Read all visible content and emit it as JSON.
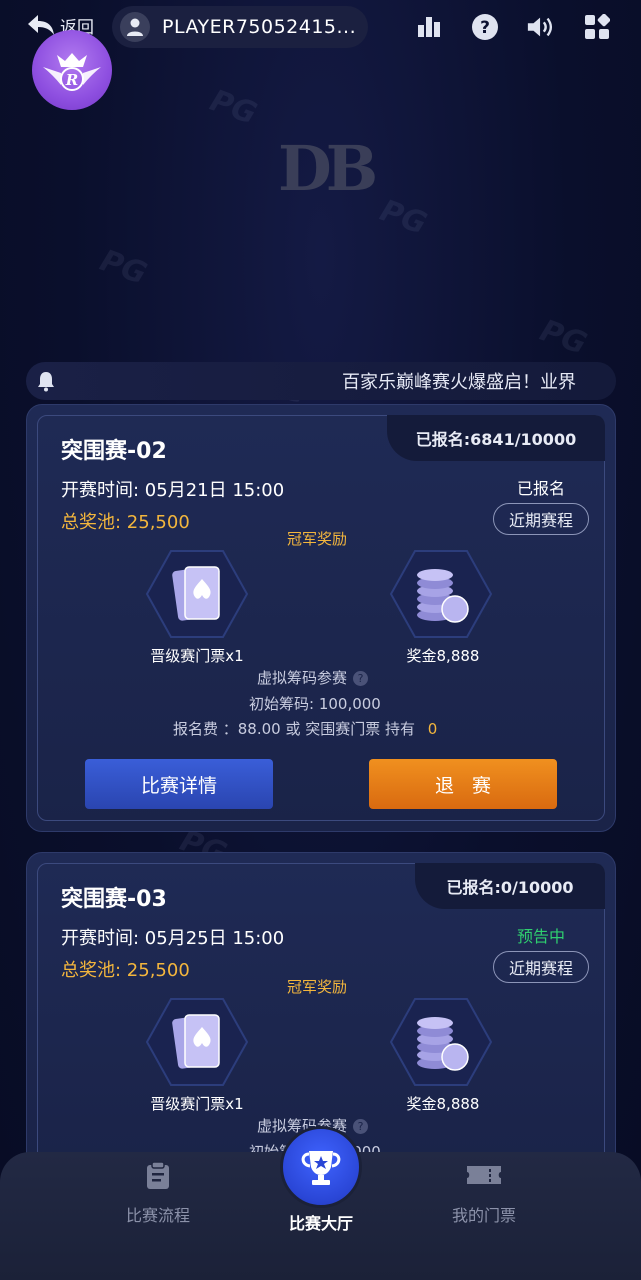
{
  "header": {
    "back_label": "返回",
    "player_name": "PLAYER75052415...",
    "icons": [
      "back-arrow-icon",
      "user-icon",
      "leaderboard-icon",
      "help-icon",
      "volume-icon",
      "menu-grid-icon"
    ]
  },
  "logo": {
    "badge_letter": "R",
    "brand_mark": "DB"
  },
  "notice": {
    "text": "百家乐巅峰赛火爆盛启！业界"
  },
  "tournaments": [
    {
      "title": "突围赛-02",
      "registered": "已报名:6841/10000",
      "start_time": "开赛时间: 05月21日 15:00",
      "prize_pool": "总奖池: 25,500",
      "status": "已报名",
      "schedule_btn": "近期赛程",
      "champion_label": "冠军奖励",
      "reward_ticket": "晋级赛门票x1",
      "reward_bonus": "奖金8,888",
      "virtual_chips": "虚拟筹码参赛",
      "initial_chips": "初始筹码: 100,000",
      "entry_fee": "报名费 ：88.00 或 突围赛门票 持有",
      "tickets_held": "0",
      "detail_btn": "比赛详情",
      "action_btn": "退赛"
    },
    {
      "title": "突围赛-03",
      "registered": "已报名:0/10000",
      "start_time": "开赛时间: 05月25日 15:00",
      "prize_pool": "总奖池: 25,500",
      "status": "预告中",
      "schedule_btn": "近期赛程",
      "champion_label": "冠军奖励",
      "reward_ticket": "晋级赛门票x1",
      "reward_bonus": "奖金8,888",
      "virtual_chips": "虚拟筹码参赛",
      "initial_chips": "初始筹码: 100,000"
    }
  ],
  "bottom_nav": {
    "items": [
      {
        "label": "比赛流程",
        "icon": "clipboard-icon"
      },
      {
        "label": "比赛大厅",
        "icon": "trophy-icon"
      },
      {
        "label": "我的门票",
        "icon": "ticket-icon"
      }
    ]
  },
  "colors": {
    "background": "#0b1030",
    "gold": "#f3b63d",
    "status_green": "#2fcf6f",
    "blue_button": "#2f4fc4",
    "orange_button": "#e47a18",
    "badge_purple": "#8e4fe0"
  }
}
